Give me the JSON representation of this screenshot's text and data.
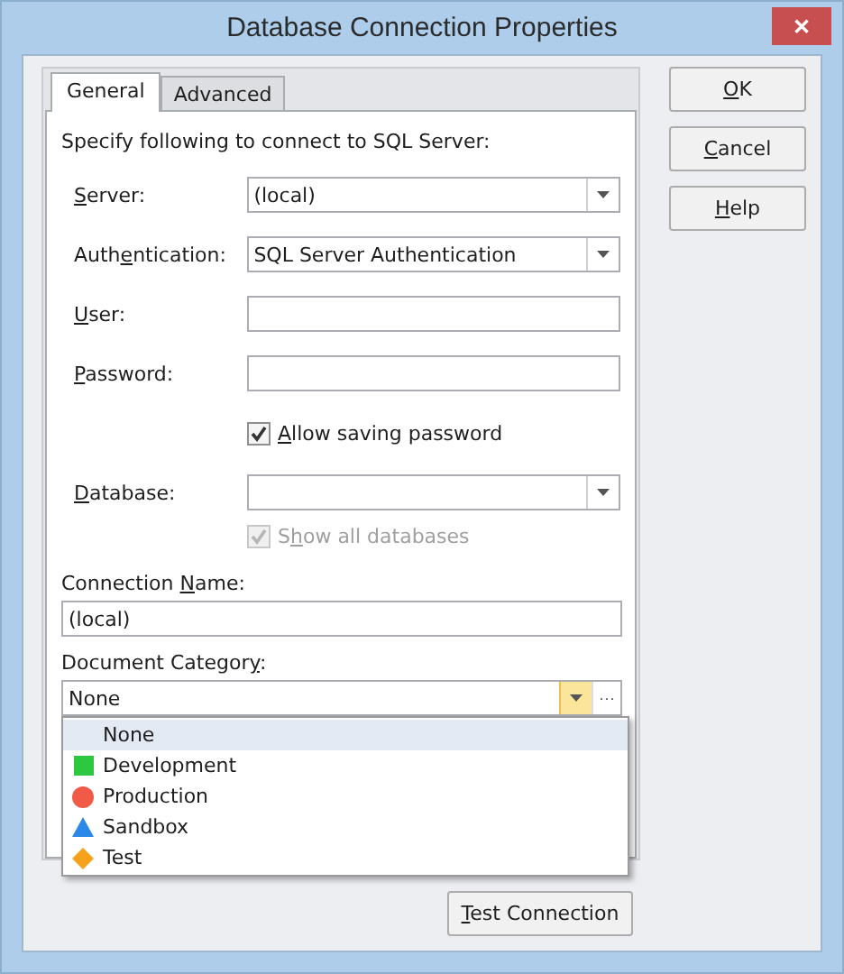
{
  "window": {
    "title": "Database Connection Properties",
    "close": "✕"
  },
  "tabs": [
    {
      "label": "General",
      "selected": true
    },
    {
      "label": "Advanced",
      "selected": false
    }
  ],
  "intro": "Specify following to connect to SQL Server:",
  "fields": [
    {
      "kind": "combo",
      "label": {
        "key": "S",
        "post": "erver:"
      },
      "value": "(local)"
    },
    {
      "kind": "combo",
      "label": {
        "pre": "Auth",
        "key": "e",
        "post": "ntication:"
      },
      "value": "SQL Server Authentication"
    },
    {
      "kind": "text",
      "label": {
        "key": "U",
        "post": "ser:"
      }
    },
    {
      "kind": "text",
      "label": {
        "key": "P",
        "post": "assword:"
      }
    },
    {
      "kind": "check",
      "label": {
        "key": "A",
        "post": "llow saving password"
      },
      "checked": true,
      "disabled": false
    },
    {
      "kind": "combo",
      "label": {
        "key": "D",
        "post": "atabase:"
      }
    },
    {
      "kind": "check",
      "label": {
        "pre": "S",
        "key": "h",
        "post": "ow all databases"
      },
      "checked": true,
      "disabled": true
    }
  ],
  "connection_name": {
    "label": {
      "pre": "Connection ",
      "key": "N",
      "post": "ame:"
    },
    "value": "(local)"
  },
  "document_category": {
    "label": {
      "pre": "Document Categor",
      "key": "y",
      "post": ":"
    },
    "value": "None",
    "ellipsis": "···",
    "expanded": true,
    "options": [
      {
        "label": "None",
        "kind": "none",
        "selected": true
      },
      {
        "label": "Development",
        "kind": "square",
        "color": "#2ec840",
        "selected": false
      },
      {
        "label": "Production",
        "kind": "circle",
        "color": "#f05a46",
        "selected": false
      },
      {
        "label": "Sandbox",
        "kind": "triangle",
        "color": "#2a88e8",
        "selected": false
      },
      {
        "label": "Test",
        "kind": "diamond",
        "color": "#f7a21c",
        "selected": false
      }
    ]
  },
  "test_button": {
    "key": "T",
    "post": "est Connection"
  },
  "buttons": [
    {
      "key": "O",
      "post": "K"
    },
    {
      "key": "C",
      "post": "ancel"
    },
    {
      "key": "H",
      "post": "elp"
    }
  ]
}
